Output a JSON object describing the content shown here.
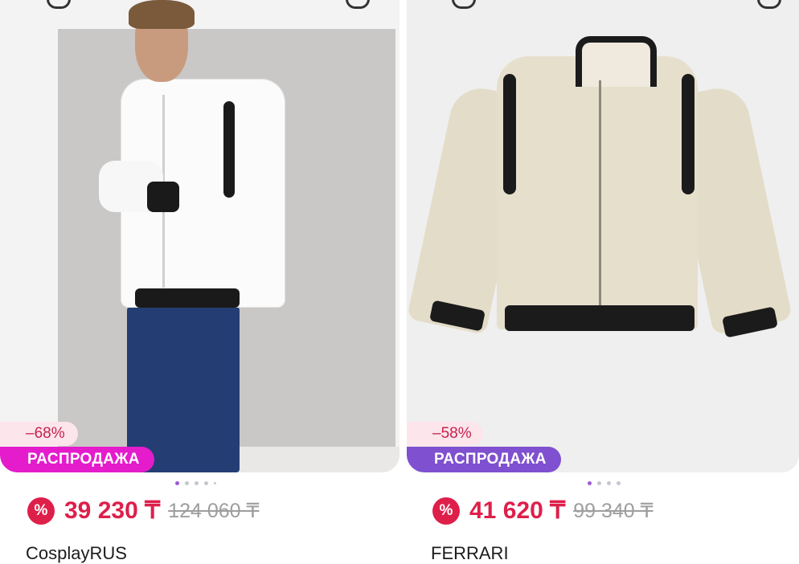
{
  "products": [
    {
      "discount": "–68%",
      "sale_label": "РАСПРОДАЖА",
      "price": "39 230 ₸",
      "old_price": "124 060 ₸",
      "brand": "CosplayRUS",
      "pct_icon": "%",
      "dots_total": 5,
      "dots_active": 1
    },
    {
      "discount": "–58%",
      "sale_label": "РАСПРОДАЖА",
      "price": "41 620 ₸",
      "old_price": "99 340 ₸",
      "brand": "FERRARI",
      "pct_icon": "%",
      "dots_total": 4,
      "dots_active": 1
    }
  ],
  "colors": {
    "price": "#de1f4a",
    "sale_pink": "#e41ccc",
    "sale_purple": "#7f50cf",
    "discount_bg": "#fde5ec"
  },
  "icons": [
    "search-icon",
    "favorite-icon",
    "percent-badge-icon"
  ]
}
